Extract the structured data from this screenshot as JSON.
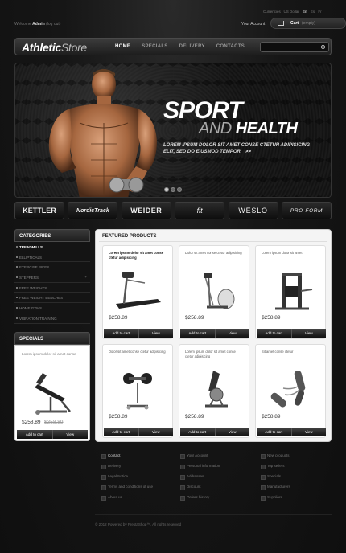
{
  "topbar": {
    "welcome_prefix": "Welcome",
    "welcome_user": "Admin",
    "welcome_suffix": "(log out)",
    "currencies_label": "Currencies : US Dollar",
    "lang_en": "En",
    "lang_es": "Es",
    "lang_fr": "Fr",
    "your_account": "Your Account",
    "cart_label": "Cart",
    "cart_state": "(empty)"
  },
  "header": {
    "logo_bold": "Athletic",
    "logo_thin": "Store",
    "nav": [
      "HOME",
      "SPECIALS",
      "DELIVERY",
      "CONTACTS"
    ],
    "search_placeholder": ""
  },
  "banner": {
    "title_1": "SPORT",
    "title_and": "AND",
    "title_2": "HEALTH",
    "text": "LOREM IPSUM DOLOR SIT AMET CONSE CTETUR ADIPISICING ELIT, SED DO EIUSMOD TEMPOR",
    "arrow": ">>"
  },
  "brands": [
    "KETTLER",
    "NordicTrack",
    "WEIDER",
    "fit",
    "WESLO",
    "PRO·FORM"
  ],
  "categories": {
    "heading": "CATEGORIES",
    "items": [
      "TREADMILLS",
      "ELLIPTICALS",
      "EXERCISE BIKES",
      "STEPPERS",
      "FREE WEIGHTS",
      "FREE WEIGHT BENCHES",
      "HOME GYMS",
      "VIBRATION TRAINING"
    ],
    "more_symbol": "+"
  },
  "specials": {
    "heading": "SPECIALS",
    "desc": "Lorem ipsum dolor sit amet conse",
    "price": "$258.89",
    "old_price": "$358.89",
    "add_to_cart": "Add to cart",
    "view": "View"
  },
  "featured": {
    "heading": "FEATURED PRODUCTS",
    "add_to_cart": "Add to cart",
    "view": "View",
    "products": [
      {
        "desc": "Lorem ipsum dolor sit amet conse ctetur adipisicing",
        "price": "$258.89",
        "img": "treadmill"
      },
      {
        "desc": "Dolor sit amet conse ctetur adipisicing",
        "price": "$258.89",
        "img": "elliptical"
      },
      {
        "desc": "Lorem ipsum dolor sit amet",
        "price": "$258.89",
        "img": "home-gym"
      },
      {
        "desc": "Dolor sit amet conse ctetur adipisicing",
        "price": "$258.89",
        "img": "dumbbell-rack"
      },
      {
        "desc": "Lorem ipsum dolor sit amet conse ctetur adipisicing",
        "price": "$258.89",
        "img": "exercise-bike"
      },
      {
        "desc": "Sit amet conse ctetur",
        "price": "$258.89",
        "img": "hand-grips"
      }
    ]
  },
  "footer": {
    "col1": [
      "Contact",
      "Delivery",
      "Legal Notice",
      "Terms and conditions of use",
      "About us"
    ],
    "col2": [
      "Your Account",
      "Personal information",
      "Addresses",
      "Discount",
      "Orders history"
    ],
    "col3": [
      "New products",
      "Top sellers",
      "Specials",
      "Manufacturers",
      "Suppliers"
    ],
    "copyright": "© 2012 Powered by PrestaShop™. All rights reserved"
  }
}
